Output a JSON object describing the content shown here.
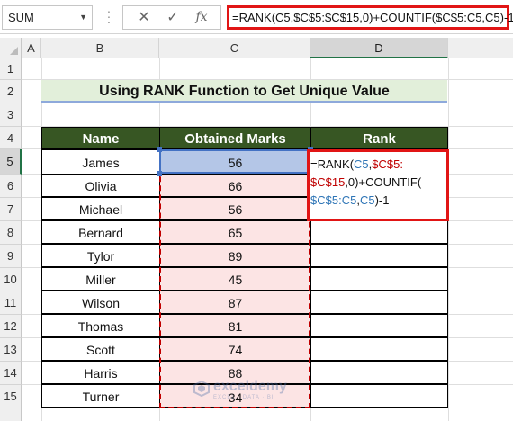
{
  "formula_bar": {
    "name_box": "SUM",
    "formula": "=RANK(C5,$C$5:$C$15,0)+COUNTIF($C$5:C5,C5)-1",
    "cancel_icon": "close-icon",
    "enter_icon": "check-icon",
    "function_icon": "fx-icon"
  },
  "sheet": {
    "columns": [
      "A",
      "B",
      "C",
      "D"
    ],
    "rows": [
      "1",
      "2",
      "3",
      "4",
      "5",
      "6",
      "7",
      "8",
      "9",
      "10",
      "11",
      "12",
      "13",
      "14",
      "15"
    ],
    "active_column": "D",
    "active_row": "5"
  },
  "title": "Using RANK Function to Get Unique Value",
  "table": {
    "headers": [
      "Name",
      "Obtained Marks",
      "Rank"
    ],
    "rows": [
      {
        "name": "James",
        "marks": "56"
      },
      {
        "name": "Olivia",
        "marks": "66"
      },
      {
        "name": "Michael",
        "marks": "56"
      },
      {
        "name": "Bernard",
        "marks": "65"
      },
      {
        "name": "Tylor",
        "marks": "89"
      },
      {
        "name": "Miller",
        "marks": "45"
      },
      {
        "name": "Wilson",
        "marks": "87"
      },
      {
        "name": "Thomas",
        "marks": "81"
      },
      {
        "name": "Scott",
        "marks": "74"
      },
      {
        "name": "Harris",
        "marks": "88"
      },
      {
        "name": "Turner",
        "marks": "34"
      }
    ]
  },
  "edit_formula": {
    "p1": "=RANK(",
    "p2": "C5",
    "p3": ",",
    "p4": "$C$5:",
    "p5": "$C$15",
    "p6": ",0)+COUNTIF(",
    "p7": "$C$5:C5",
    "p8": ",",
    "p9": "C5",
    "p10": ")-1"
  },
  "watermark": {
    "name": "exceldemy",
    "tagline": "EXCEL · DATA · BI"
  },
  "colors": {
    "header_fill": "#375623",
    "title_fill": "#e2efda",
    "marks_fill": "#fce4e4",
    "highlight_red": "#e11515",
    "select_blue": "#4472c4"
  }
}
